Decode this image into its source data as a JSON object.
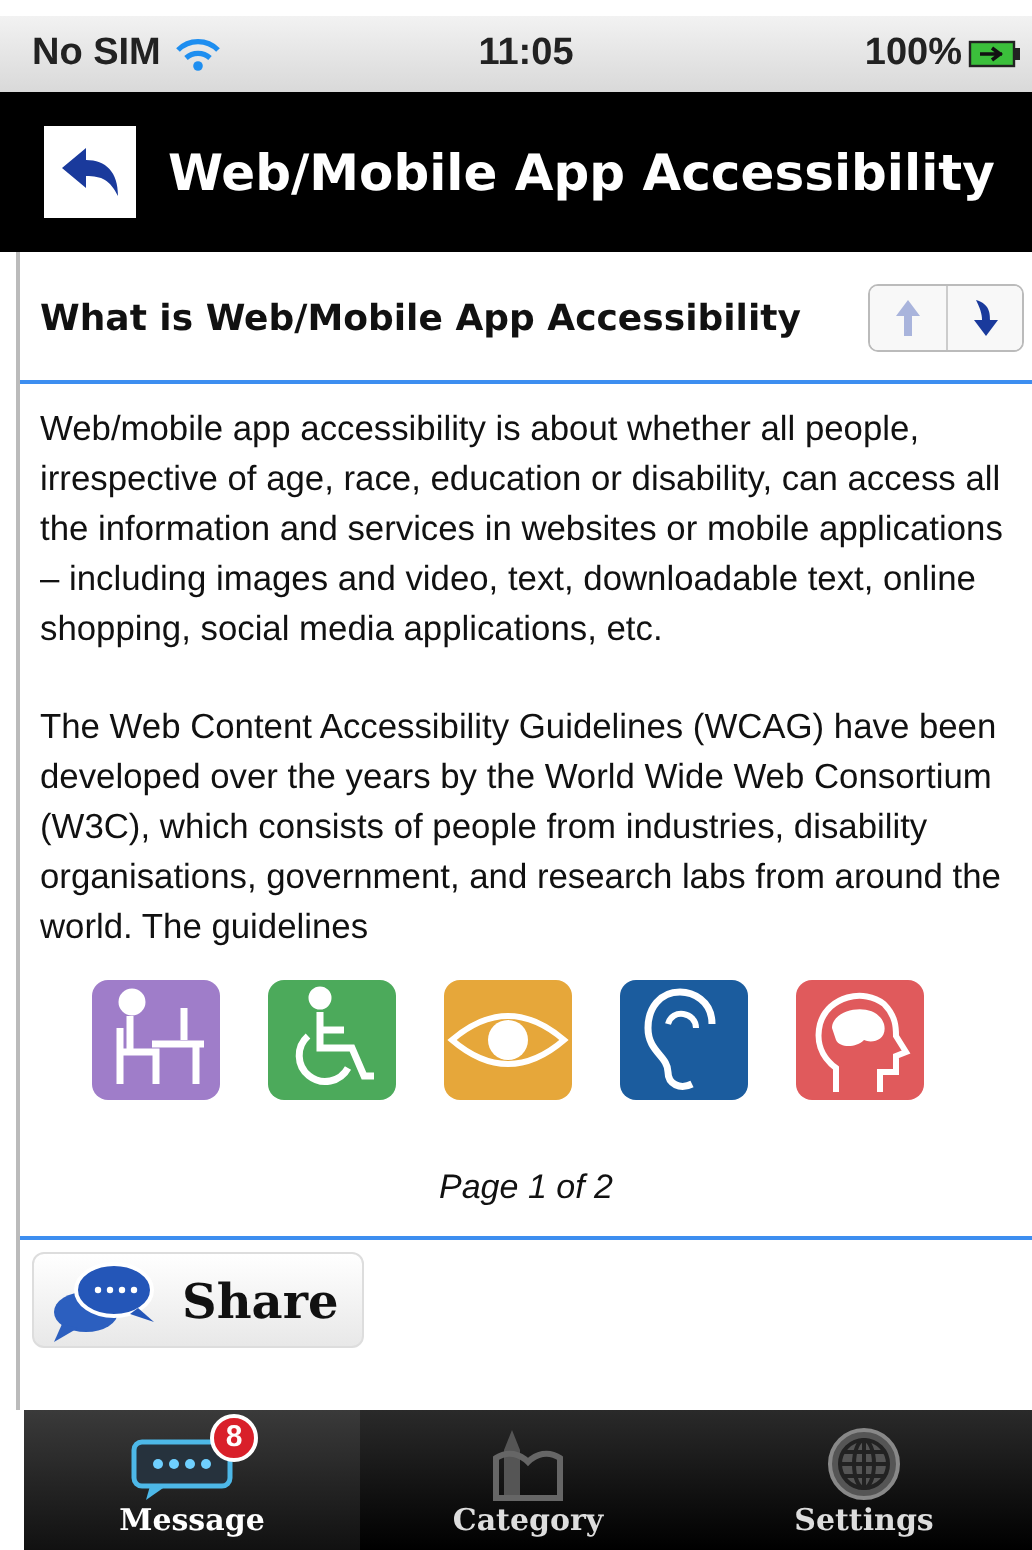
{
  "status_bar": {
    "carrier": "No SIM",
    "time": "11:05",
    "battery": "100%"
  },
  "header": {
    "title": "Web/Mobile App Accessibility"
  },
  "section": {
    "title": "What is Web/Mobile App Accessibility",
    "pager": [
      {
        "kind": "up",
        "disabled": true
      },
      {
        "kind": "down",
        "disabled": false
      }
    ]
  },
  "paragraphs": [
    "Web/mobile app accessibility is about whether all people, irrespective of age, race, education or disability, can access all the information and services in websites or mobile applications – including images and video, text, downloadable text, online shopping, social media applications, etc.",
    "The Web Content Accessibility Guidelines (WCAG) have been developed over the years by the World Wide Web Consortium (W3C), which consists of people from industries, disability organisations, government, and research labs from around the world. The guidelines"
  ],
  "page_label": "Page 1 of 2",
  "share_button": "Share",
  "tabs": [
    {
      "kind": "message",
      "label": "Message",
      "selected": true,
      "badge": "8"
    },
    {
      "kind": "category",
      "label": "Category",
      "selected": false
    },
    {
      "kind": "settings",
      "label": "Settings",
      "selected": false
    }
  ]
}
